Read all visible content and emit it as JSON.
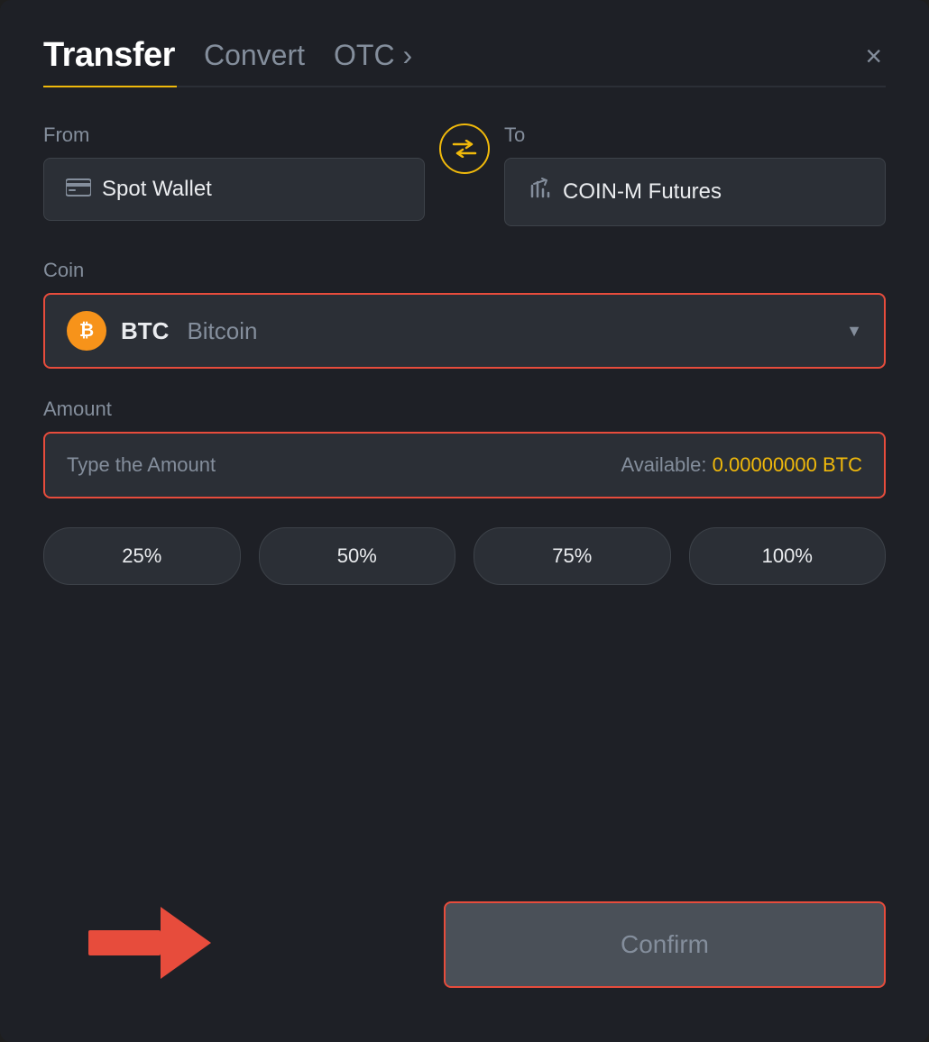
{
  "header": {
    "title": "Transfer",
    "tabs": [
      {
        "label": "Transfer",
        "active": true
      },
      {
        "label": "Convert",
        "active": false
      },
      {
        "label": "OTC ›",
        "active": false
      }
    ],
    "close_label": "×"
  },
  "from_section": {
    "label": "From",
    "wallet_icon": "▬",
    "wallet_text": "Spot Wallet"
  },
  "swap_button": {
    "icon": "⇄"
  },
  "to_section": {
    "label": "To",
    "wallet_icon": "↑",
    "wallet_text": "COIN-M Futures"
  },
  "coin_section": {
    "label": "Coin",
    "coin_symbol": "BTC",
    "coin_name": "Bitcoin",
    "coin_icon": "₿"
  },
  "amount_section": {
    "label": "Amount",
    "placeholder": "Type the Amount",
    "available_label": "Available:",
    "available_amount": "0.00000000 BTC"
  },
  "pct_buttons": [
    {
      "label": "25%"
    },
    {
      "label": "50%"
    },
    {
      "label": "75%"
    },
    {
      "label": "100%"
    }
  ],
  "confirm_button": {
    "label": "Confirm"
  },
  "colors": {
    "accent": "#f0b90b",
    "danger": "#e74c3c",
    "bg": "#1e2026",
    "secondary_bg": "#2b2f36",
    "text_primary": "#eaecef",
    "text_secondary": "#848e9c"
  }
}
